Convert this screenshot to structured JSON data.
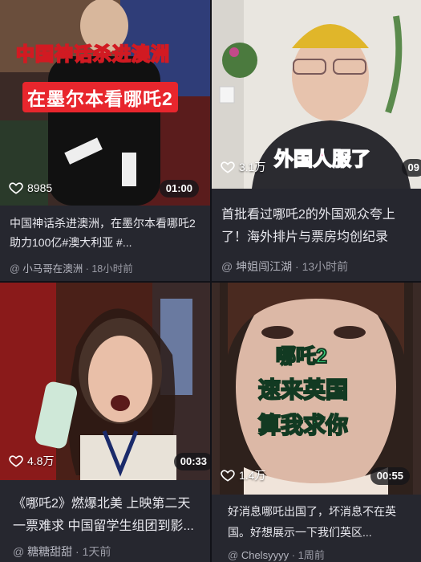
{
  "feed": {
    "cards": [
      {
        "overlay_lines": [
          "中国神话杀进澳洲",
          "在墨尔本看哪吒2"
        ],
        "likes": "8985",
        "duration": "01:00",
        "caption": "中国神话杀进澳洲，在墨尔本看哪吒2助力100亿#澳大利亚 #...",
        "author": "小马哥在澳洲",
        "time": "18小时前"
      },
      {
        "overlay_lines": [
          "外国人服了"
        ],
        "likes": "3.1万",
        "duration": "09",
        "caption": "首批看过哪吒2的外国观众夸上了！海外排片与票房均创纪录",
        "author": "坤姐闯江湖",
        "time": "13小时前"
      },
      {
        "overlay_lines": [],
        "likes": "4.8万",
        "duration": "00:33",
        "caption": "《哪吒2》燃爆北美 上映第二天一票难求 中国留学生组团到影...",
        "author": "糖糖甜甜",
        "time": "1天前"
      },
      {
        "overlay_lines": [
          "哪吒2",
          "速来英国",
          "算我求你"
        ],
        "likes": "1.4万",
        "duration": "00:55",
        "caption": "好消息哪吒出国了，坏消息不在英国。好想展示一下我们英区...",
        "author": "Chelsyyyy",
        "time": "1周前"
      }
    ]
  },
  "colors": {
    "overlay_red": "#e8262d",
    "overlay_green": "#34d07a",
    "overlay_pink": "#ff3f8a",
    "background": "#111218",
    "card": "#26272f"
  }
}
